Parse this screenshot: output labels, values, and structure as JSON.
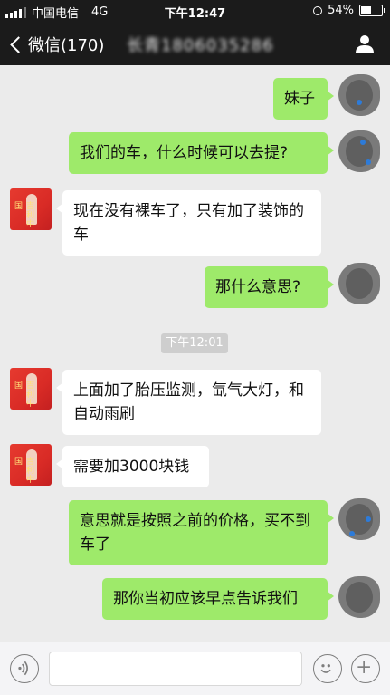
{
  "status_bar": {
    "carrier": "中国电信",
    "network": "4G",
    "time": "下午12:47",
    "battery": "54%",
    "battery_level": 0.54
  },
  "nav": {
    "back_label": "微信(170)",
    "title": "长青1806035286"
  },
  "messages": [
    {
      "side": "me",
      "text": "妹子"
    },
    {
      "side": "me",
      "text": "我们的车，什么时候可以去提?"
    },
    {
      "side": "other",
      "text": "现在没有裸车了，只有加了装饰的车"
    },
    {
      "side": "me",
      "text": "那什么意思?"
    },
    {
      "side": "other",
      "text": "上面加了胎压监测，氙气大灯，和自动雨刷"
    },
    {
      "side": "other",
      "text": "需要加3000块钱"
    },
    {
      "side": "me",
      "text": "意思就是按照之前的价格，买不到车了"
    },
    {
      "side": "me",
      "text": "那你当初应该早点告诉我们"
    }
  ],
  "timestamp": "下午12:01",
  "avatar_text": "吉利中国",
  "colors": {
    "my_bubble": "#9eea6a",
    "other_bubble": "#ffffff",
    "background": "#ebebeb"
  },
  "icons": {
    "voice": "voice-icon",
    "emoji": "emoji-icon",
    "plus": "plus-icon",
    "profile": "profile-icon"
  }
}
